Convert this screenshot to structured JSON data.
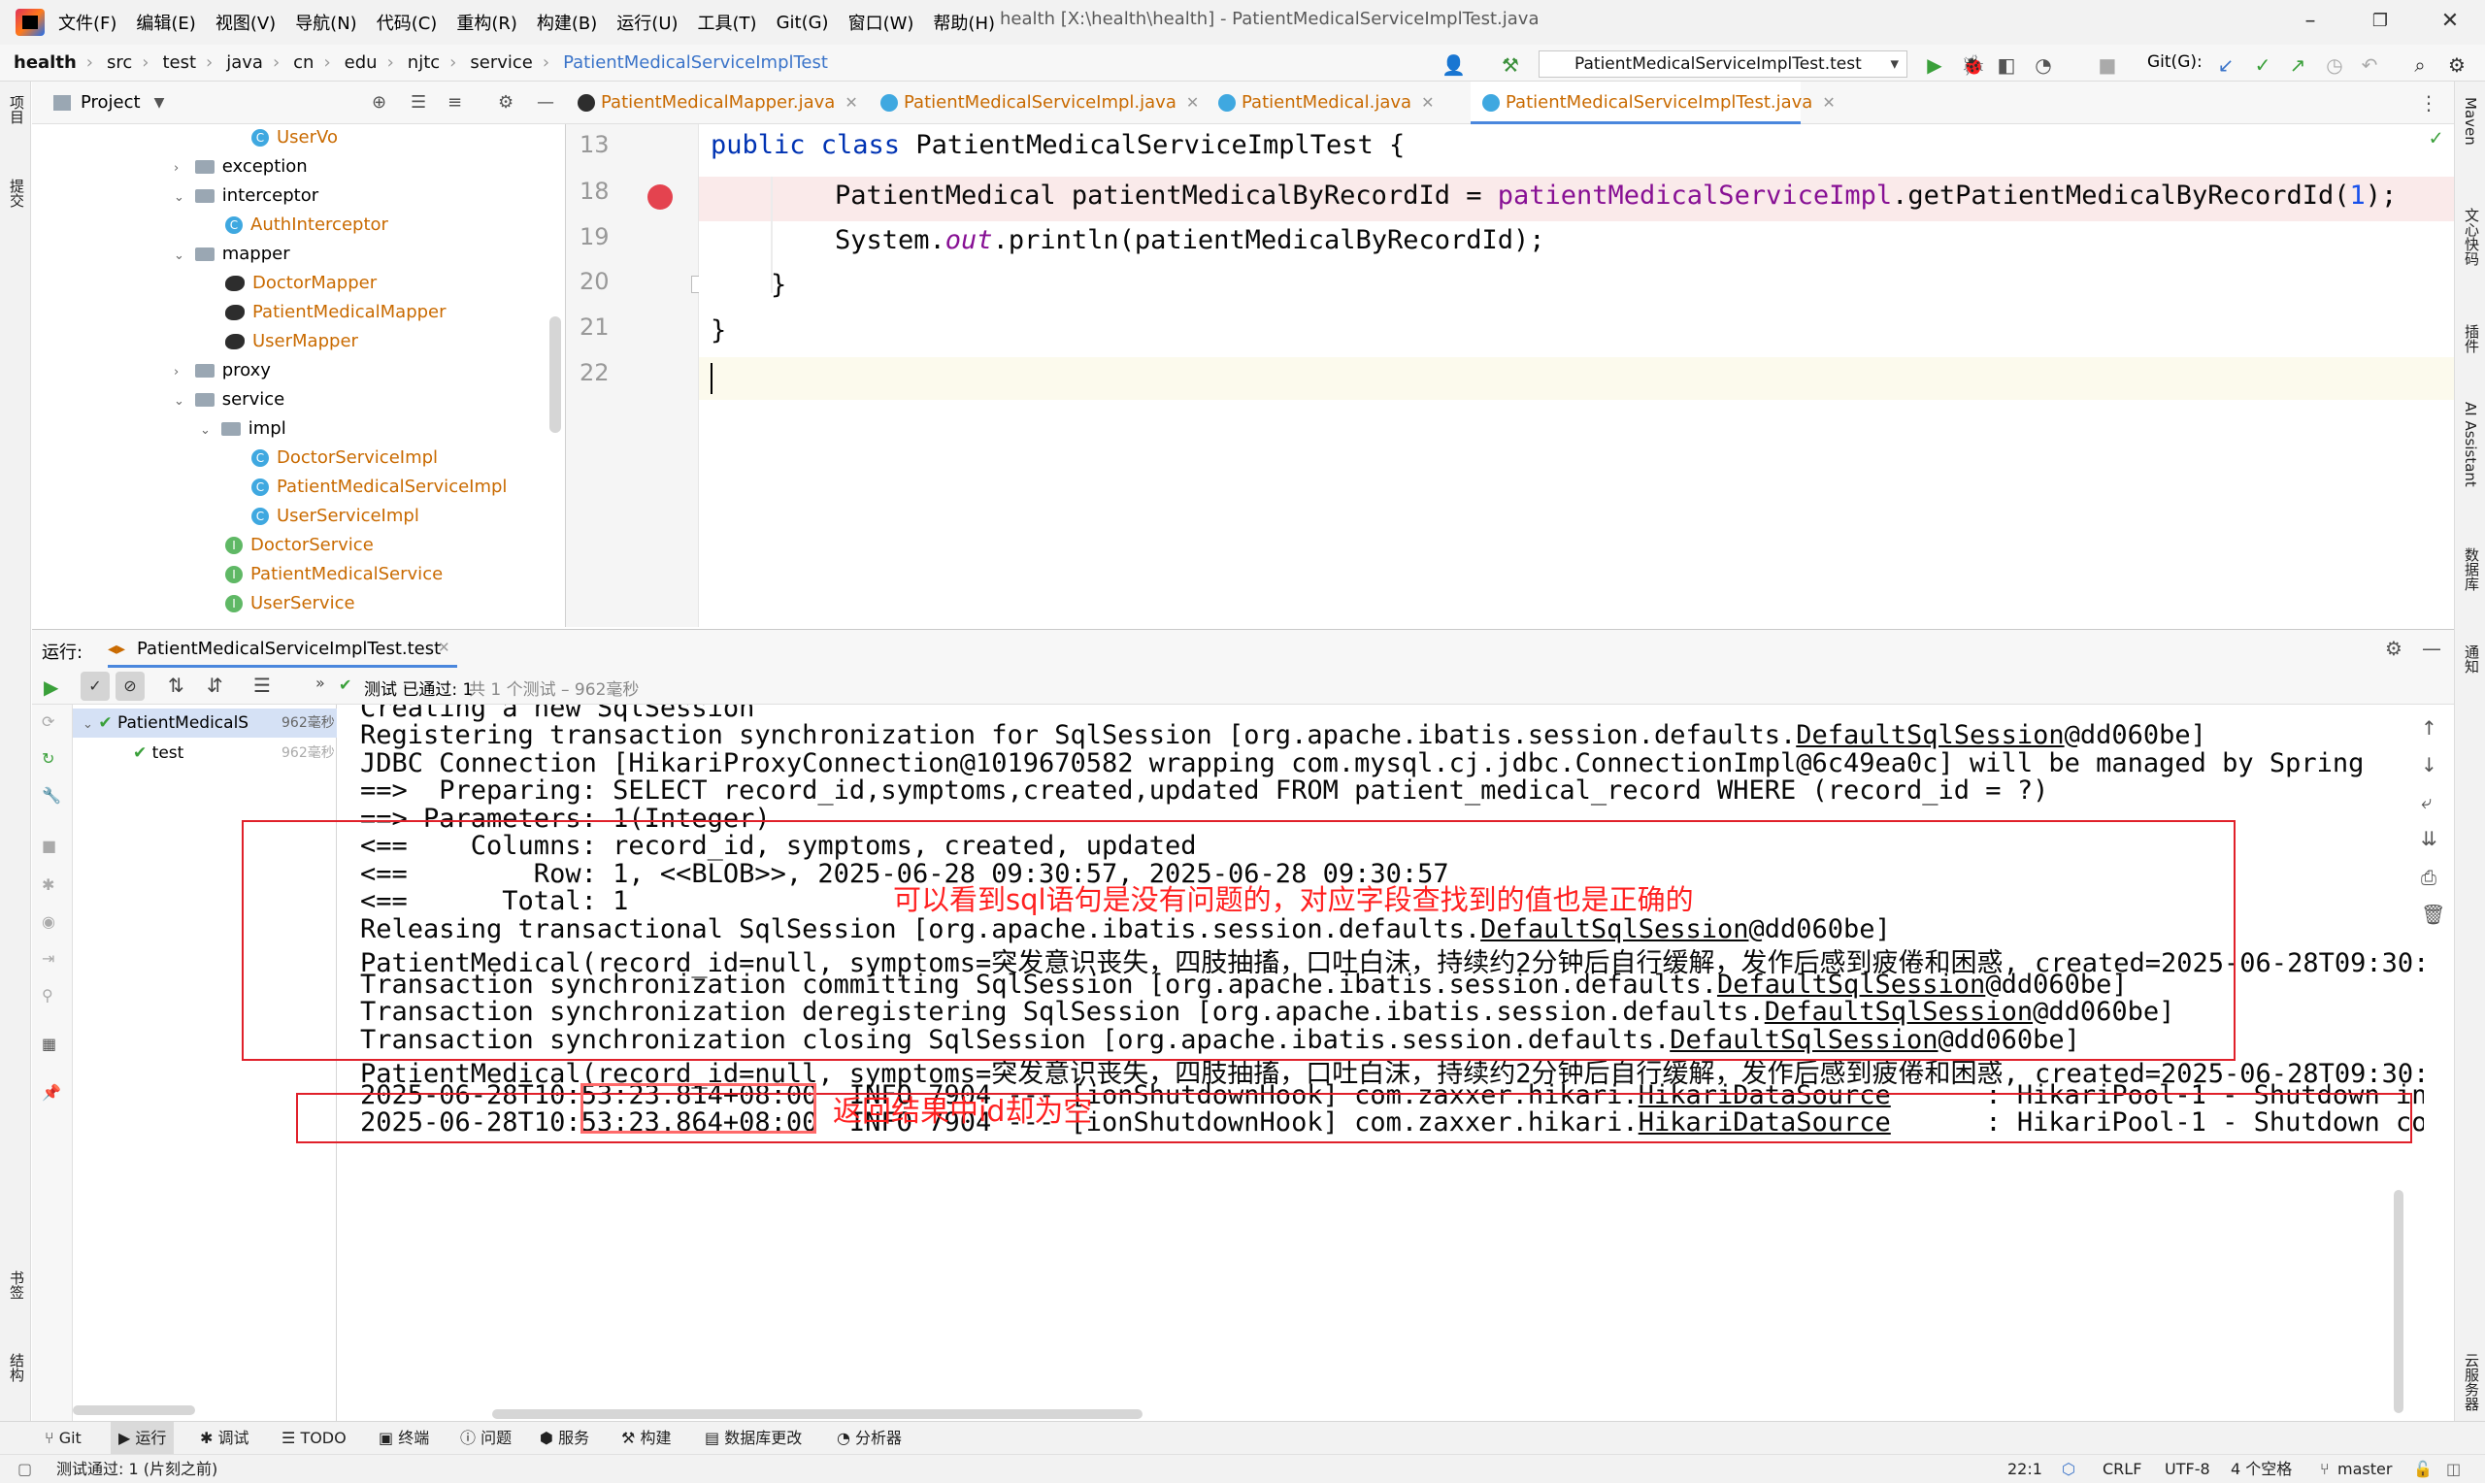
{
  "menu": [
    "文件(F)",
    "编辑(E)",
    "视图(V)",
    "导航(N)",
    "代码(C)",
    "重构(R)",
    "构建(B)",
    "运行(U)",
    "工具(T)",
    "Git(G)",
    "窗口(W)",
    "帮助(H)"
  ],
  "window_title": "health [X:\\health\\health] - PatientMedicalServiceImplTest.java",
  "breadcrumb": [
    "health",
    "src",
    "test",
    "java",
    "cn",
    "edu",
    "njtc",
    "service",
    "PatientMedicalServiceImplTest"
  ],
  "run_config": "PatientMedicalServiceImplTest.test",
  "git_label": "Git(G):",
  "left_stripe": {
    "project": "项目",
    "commit": "提交",
    "bookmarks": "书签",
    "structure": "结构"
  },
  "right_stripe": {
    "maven": "Maven",
    "doc": "文心快码",
    "plugin": "插件",
    "ai": "AI Assistant",
    "db": "数据库",
    "notify": "通知",
    "cloud": "云服务器"
  },
  "project_panel": {
    "title": "Project",
    "items": [
      {
        "label": "UserVo",
        "type": "class",
        "level": 3
      },
      {
        "label": "exception",
        "type": "folder",
        "level": 1,
        "expanded": false
      },
      {
        "label": "interceptor",
        "type": "folder",
        "level": 1,
        "expanded": true
      },
      {
        "label": "AuthInterceptor",
        "type": "class",
        "level": 2
      },
      {
        "label": "mapper",
        "type": "folder",
        "level": 1,
        "expanded": true
      },
      {
        "label": "DoctorMapper",
        "type": "mapper",
        "level": 2
      },
      {
        "label": "PatientMedicalMapper",
        "type": "mapper",
        "level": 2
      },
      {
        "label": "UserMapper",
        "type": "mapper",
        "level": 2
      },
      {
        "label": "proxy",
        "type": "folder",
        "level": 1,
        "expanded": false
      },
      {
        "label": "service",
        "type": "folder",
        "level": 1,
        "expanded": true
      },
      {
        "label": "impl",
        "type": "folder",
        "level": 2,
        "expanded": true
      },
      {
        "label": "DoctorServiceImpl",
        "type": "class",
        "level": 3
      },
      {
        "label": "PatientMedicalServiceImpl",
        "type": "class",
        "level": 3
      },
      {
        "label": "UserServiceImpl",
        "type": "class",
        "level": 3
      },
      {
        "label": "DoctorService",
        "type": "interface",
        "level": 2
      },
      {
        "label": "PatientMedicalService",
        "type": "interface",
        "level": 2
      },
      {
        "label": "UserService",
        "type": "interface",
        "level": 2
      }
    ]
  },
  "editor_tabs": [
    {
      "label": "PatientMedicalMapper.java",
      "active": false
    },
    {
      "label": "PatientMedicalServiceImpl.java",
      "active": false
    },
    {
      "label": "PatientMedical.java",
      "active": false
    },
    {
      "label": "PatientMedicalServiceImplTest.java",
      "active": true
    }
  ],
  "code": {
    "line_numbers": [
      "13",
      "18",
      "19",
      "20",
      "21",
      "22"
    ],
    "l13_kw": "public class",
    "l13_rest": " PatientMedicalServiceImplTest {",
    "l18_type": "PatientMedical patientMedicalByRecordId = ",
    "l18_field": "patientMedicalServiceImpl",
    "l18_call": ".getPatientMedicalByRecordId(",
    "l18_num": "1",
    "l18_end": ");",
    "l19_a": "System.",
    "l19_out": "out",
    "l19_b": ".println(patientMedicalByRecordId);",
    "l20": "}",
    "l21": "}"
  },
  "run_panel": {
    "label": "运行:",
    "tab": "PatientMedicalServiceImplTest.test",
    "summary_prefix": "测试 已通过: 1",
    "summary_suffix": "共 1 个测试 – 962毫秒",
    "tree": [
      {
        "label": "PatientMedicalS",
        "time": "962毫秒"
      },
      {
        "label": "test",
        "time": "962毫秒"
      }
    ]
  },
  "console": [
    {
      "text": "Creating a new SqlSession"
    },
    {
      "text": "Registering transaction synchronization for SqlSession [org.apache.ibatis.session.defaults.",
      "link": "DefaultSqlSession",
      "tail": "@dd060be]"
    },
    {
      "text": "JDBC Connection [HikariProxyConnection@1019670582 wrapping com.mysql.cj.jdbc.ConnectionImpl@6c49ea0c] will be managed by Spring"
    },
    {
      "text": "==>  Preparing: SELECT record_id,symptoms,created,updated FROM patient_medical_record WHERE (record_id = ?)"
    },
    {
      "text": "==> Parameters: 1(Integer)"
    },
    {
      "text": "<==    Columns: record_id, symptoms, created, updated"
    },
    {
      "text": "<==        Row: 1, <<BLOB>>, 2025-06-28 09:30:57, 2025-06-28 09:30:57"
    },
    {
      "text": "<==      Total: 1"
    },
    {
      "text": "Releasing transactional SqlSession [org.apache.ibatis.session.defaults.",
      "link": "DefaultSqlSession",
      "tail": "@dd060be]"
    },
    {
      "text": "PatientMedical(record_id=null, symptoms=突发意识丧失，四肢抽搐，口吐白沫，持续约2分钟后自行缓解，发作后感到疲倦和困惑, created=2025-06-28T09:30:"
    },
    {
      "text": "Transaction synchronization committing SqlSession [org.apache.ibatis.session.defaults.",
      "link": "DefaultSqlSession",
      "tail": "@dd060be]"
    },
    {
      "text": "Transaction synchronization deregistering SqlSession [org.apache.ibatis.session.defaults.",
      "link": "DefaultSqlSession",
      "tail": "@dd060be]"
    },
    {
      "text": "Transaction synchronization closing SqlSession [org.apache.ibatis.session.defaults.",
      "link": "DefaultSqlSession",
      "tail": "@dd060be]"
    },
    {
      "text": "PatientMedical(record_id=null, symptoms=突发意识丧失，四肢抽搐，口吐白沫，持续约2分钟后自行缓解，发作后感到疲倦和困惑, created=2025-06-28T09:30:"
    },
    {
      "text": "2025-06-28T10:53:23.814+08:00  INFO 7904 --- [ionShutdownHook] com.zaxxer.hikari.",
      "link": "HikariDataSource",
      "tail": "      : HikariPool-1 - Shutdown in"
    },
    {
      "text": "2025-06-28T10:53:23.864+08:00  INFO 7904 --- [ionShutdownHook] com.zaxxer.hikari.",
      "link": "HikariDataSource",
      "tail": "      : HikariPool-1 - Shutdown co"
    }
  ],
  "annotations": {
    "sql_note": "可以看到sql语句是没有问题的，对应字段查找到的值也是正确的",
    "result_note": "返回结果中id却为空"
  },
  "bottom_tools": [
    "Git",
    "运行",
    "调试",
    "TODO",
    "终端",
    "问题",
    "服务",
    "构建",
    "数据库更改",
    "分析器"
  ],
  "status": {
    "message": "测试通过: 1 (片刻之前)",
    "position": "22:1",
    "line_sep": "CRLF",
    "encoding": "UTF-8",
    "indent": "4 个空格",
    "branch": "master"
  },
  "colors": {
    "accent": "#4a87dd",
    "annotation": "#ff2020",
    "class_link": "#c96a00",
    "keyword": "#0033b3",
    "field": "#871094"
  }
}
